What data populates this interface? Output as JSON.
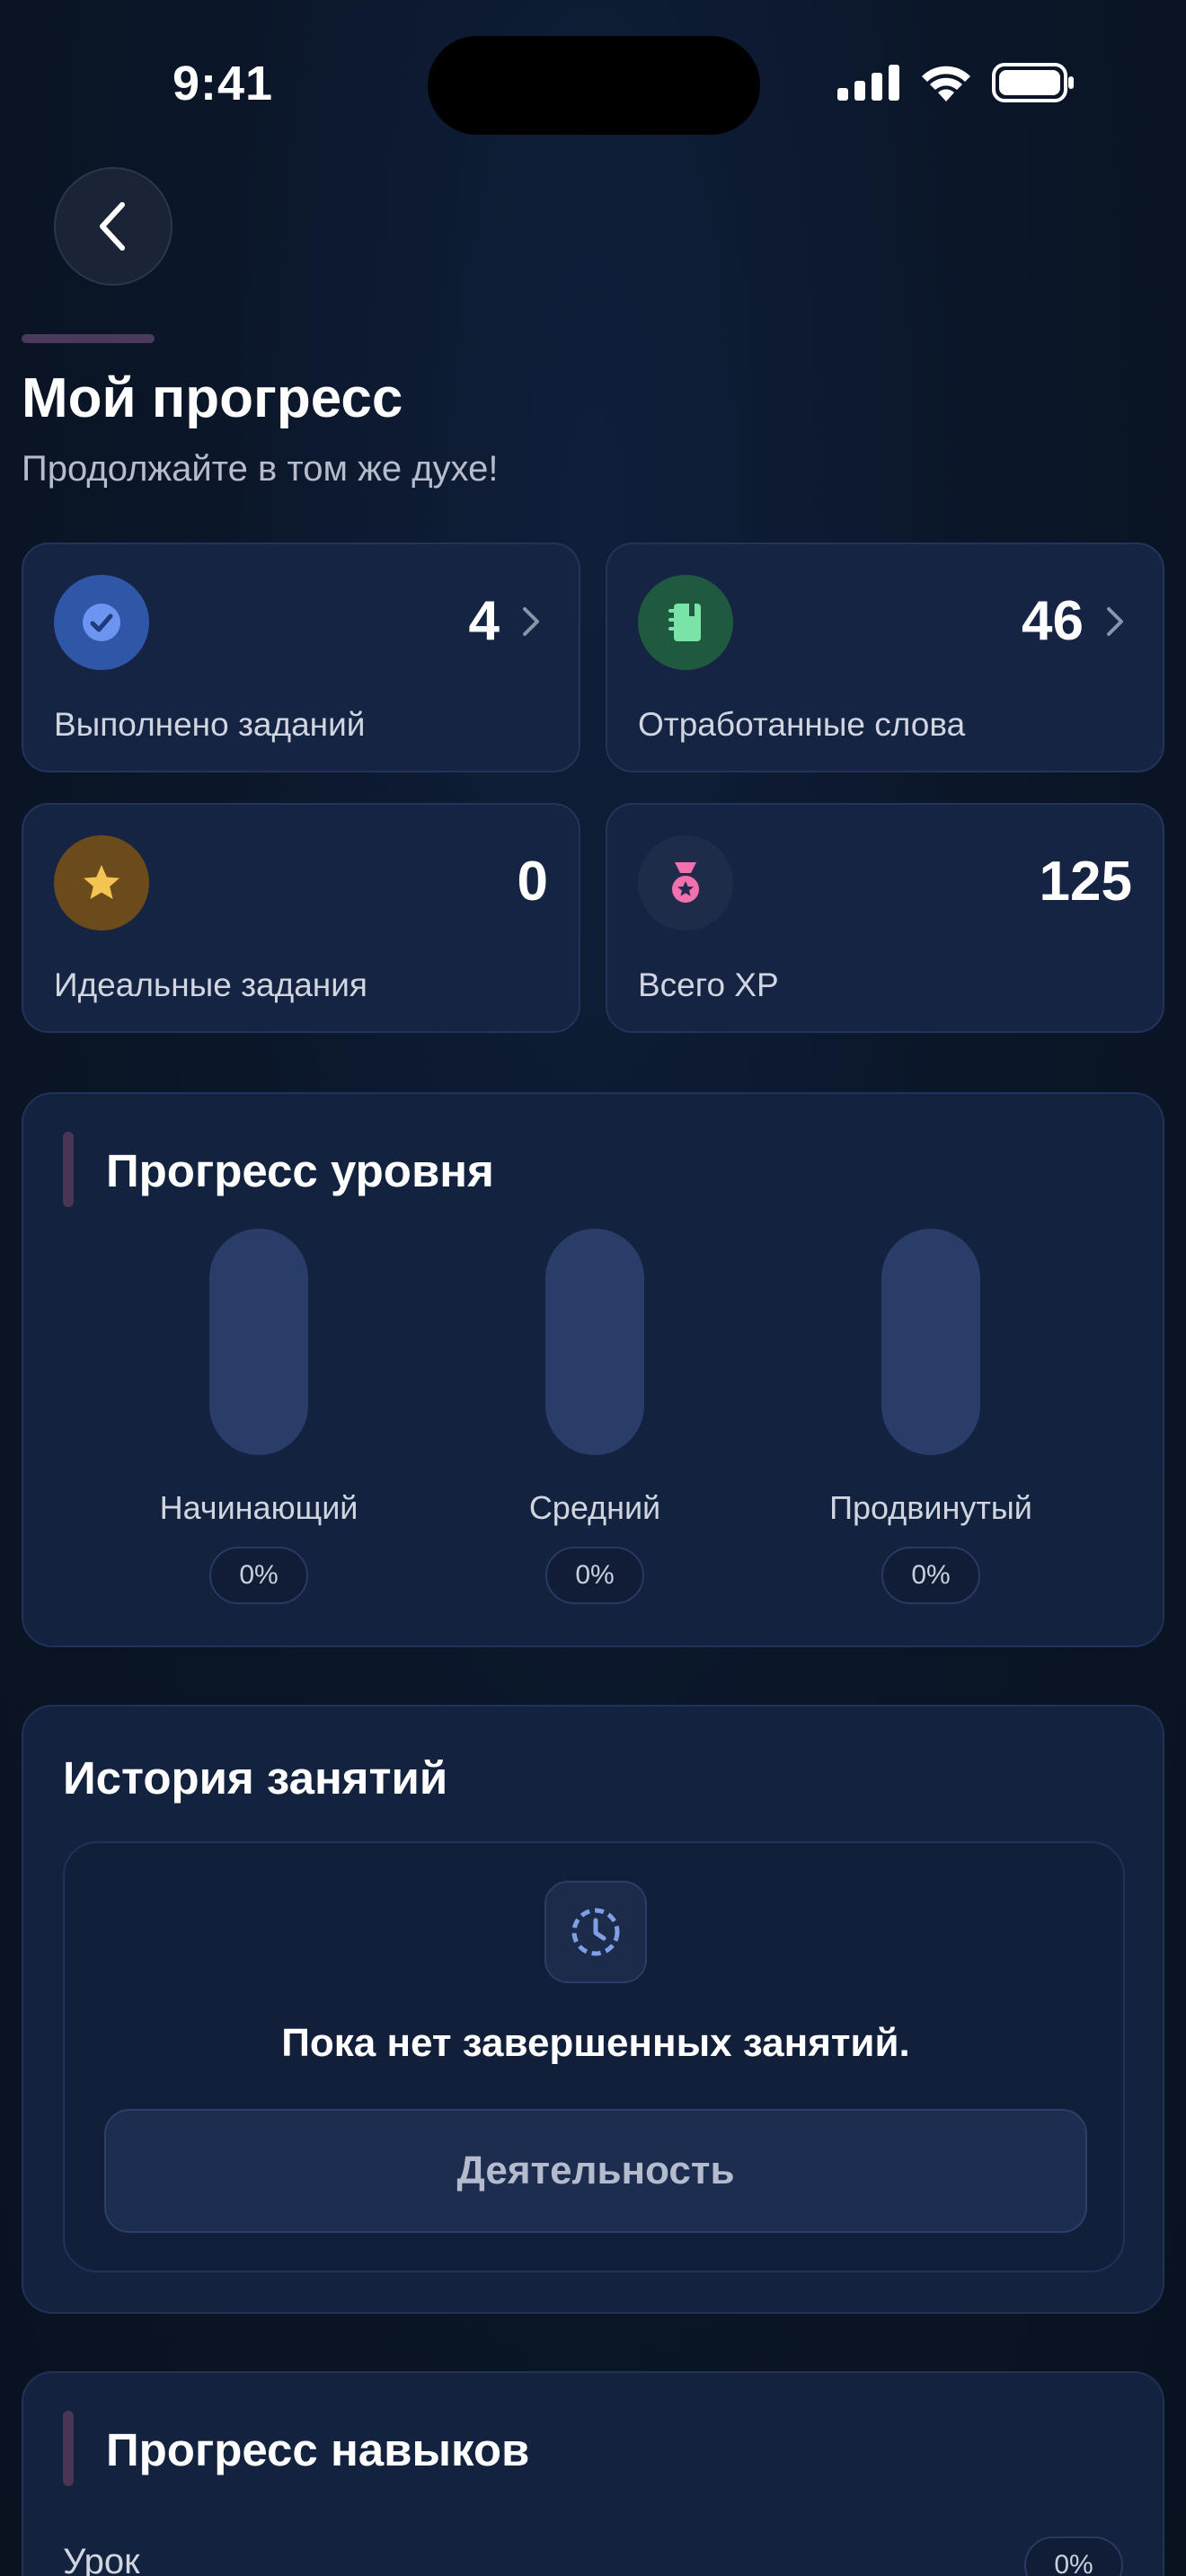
{
  "status_bar": {
    "time": "9:41"
  },
  "header": {
    "title": "Мой прогресс",
    "subtitle": "Продолжайте в том же духе!"
  },
  "stats": [
    {
      "label": "Выполнено заданий",
      "value": "4",
      "icon": "check-circle-icon",
      "color": "#5a86e6"
    },
    {
      "label": "Отработанные слова",
      "value": "46",
      "icon": "notebook-icon",
      "color": "#6fe0a0"
    },
    {
      "label": "Идеальные задания",
      "value": "0",
      "icon": "star-icon",
      "color": "#f0c050"
    },
    {
      "label": "Всего XP",
      "value": "125",
      "icon": "medal-icon",
      "color": "#f06aa8"
    }
  ],
  "level_progress": {
    "title": "Прогресс уровня",
    "levels": [
      {
        "name": "Начинающий",
        "percent": "0%",
        "fraction": 0
      },
      {
        "name": "Средний",
        "percent": "0%",
        "fraction": 0
      },
      {
        "name": "Продвинутый",
        "percent": "0%",
        "fraction": 0
      }
    ]
  },
  "history": {
    "title": "История занятий",
    "empty_text": "Пока нет завершенных занятий.",
    "button_label": "Деятельность"
  },
  "skills": {
    "title": "Прогресс навыков",
    "items": [
      {
        "label": "Урок",
        "percent": "0%"
      }
    ]
  }
}
